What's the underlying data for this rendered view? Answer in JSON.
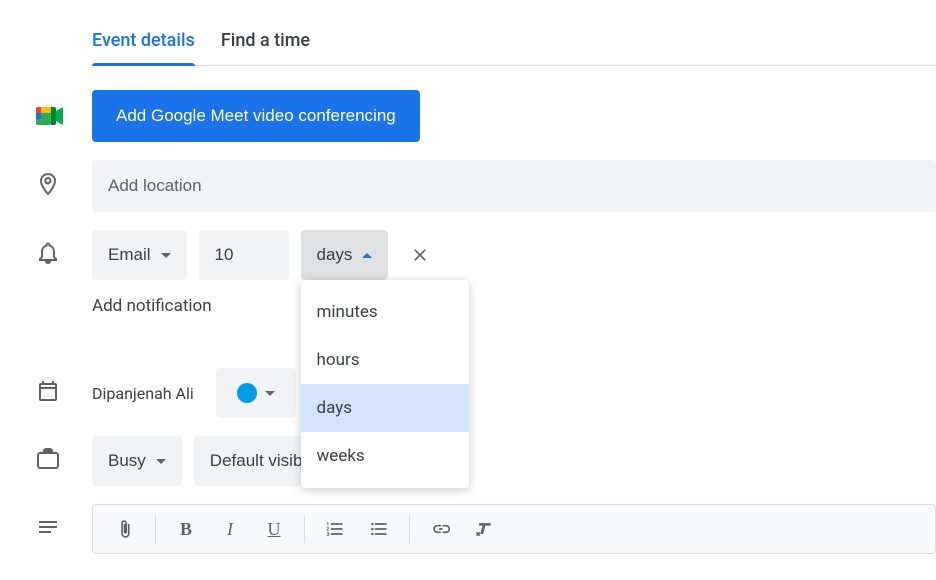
{
  "tabs": {
    "event_details": "Event details",
    "find_time": "Find a time"
  },
  "meet": {
    "button_label": "Add Google Meet video conferencing"
  },
  "location": {
    "placeholder": "Add location"
  },
  "notification": {
    "method": "Email",
    "value": "10",
    "unit_selected": "days",
    "add_label": "Add notification",
    "unit_options": [
      "minutes",
      "hours",
      "days",
      "weeks"
    ]
  },
  "calendar": {
    "owner": "Dipanjenah Ali",
    "color": "#039be5"
  },
  "availability": {
    "busy": "Busy",
    "visibility": "Default visibility"
  }
}
